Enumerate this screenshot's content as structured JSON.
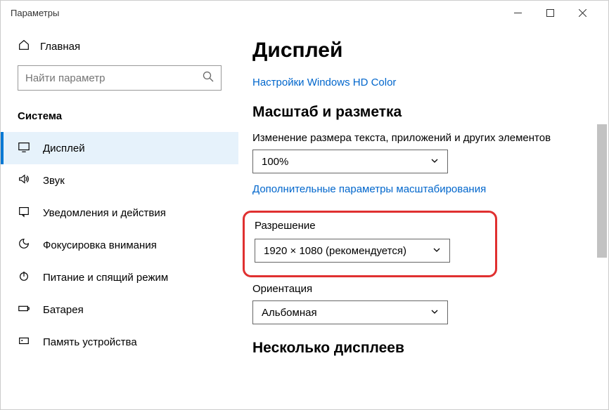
{
  "window": {
    "title": "Параметры"
  },
  "home": {
    "label": "Главная"
  },
  "search": {
    "placeholder": "Найти параметр"
  },
  "section": {
    "label": "Система"
  },
  "nav": {
    "display": "Дисплей",
    "sound": "Звук",
    "notifications": "Уведомления и действия",
    "focus": "Фокусировка внимания",
    "power": "Питание и спящий режим",
    "battery": "Батарея",
    "storage": "Память устройства"
  },
  "main": {
    "title": "Дисплей",
    "hd_color_link": "Настройки Windows HD Color",
    "scale_heading": "Масштаб и разметка",
    "scale_label": "Изменение размера текста, приложений и других элементов",
    "scale_value": "100%",
    "adv_scale_link": "Дополнительные параметры масштабирования",
    "res_label": "Разрешение",
    "res_value": "1920 × 1080 (рекомендуется)",
    "orient_label": "Ориентация",
    "orient_value": "Альбомная",
    "multi_heading": "Несколько дисплеев"
  }
}
